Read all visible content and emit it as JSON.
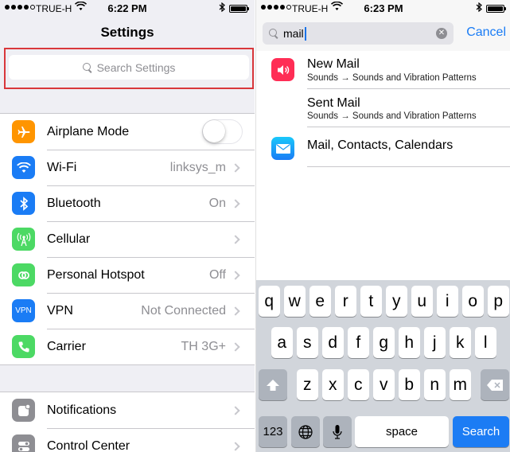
{
  "left": {
    "status": {
      "carrier": "TRUE-H",
      "time": "6:22 PM"
    },
    "title": "Settings",
    "search_placeholder": "Search Settings",
    "group1": [
      {
        "label": "Airplane Mode",
        "detail": "",
        "icon": "airplane-icon",
        "color": "#ff9500",
        "toggle": false
      },
      {
        "label": "Wi-Fi",
        "detail": "linksys_m",
        "icon": "wifi-icon",
        "color": "#1a7cf5"
      },
      {
        "label": "Bluetooth",
        "detail": "On",
        "icon": "bluetooth-icon",
        "color": "#1a7cf5"
      },
      {
        "label": "Cellular",
        "detail": "",
        "icon": "cellular-icon",
        "color": "#4cd964"
      },
      {
        "label": "Personal Hotspot",
        "detail": "Off",
        "icon": "hotspot-icon",
        "color": "#4cd964"
      },
      {
        "label": "VPN",
        "detail": "Not Connected",
        "icon": "vpn-icon",
        "color": "#1a7cf5",
        "icon_text": "VPN"
      },
      {
        "label": "Carrier",
        "detail": "TH 3G+",
        "icon": "phone-icon",
        "color": "#4cd964"
      }
    ],
    "group2": [
      {
        "label": "Notifications",
        "icon": "notifications-icon",
        "color": "#8e8e93"
      },
      {
        "label": "Control Center",
        "icon": "control-center-icon",
        "color": "#8e8e93"
      }
    ]
  },
  "right": {
    "status": {
      "carrier": "TRUE-H",
      "time": "6:23 PM"
    },
    "search_value": "mail",
    "cancel_label": "Cancel",
    "results": [
      {
        "title": "New Mail",
        "subtitle": "Sounds → Sounds and Vibration Patterns",
        "icon": "sounds-icon",
        "color": "#ff2d55"
      },
      {
        "title": "Sent Mail",
        "subtitle": "Sounds → Sounds and Vibration Patterns",
        "icon": "",
        "color": ""
      },
      {
        "title": "Mail, Contacts, Calendars",
        "subtitle": "",
        "icon": "mail-icon",
        "color": "#1a9bf4"
      }
    ],
    "keyboard": {
      "row1": [
        "q",
        "w",
        "e",
        "r",
        "t",
        "y",
        "u",
        "i",
        "o",
        "p"
      ],
      "row2": [
        "a",
        "s",
        "d",
        "f",
        "g",
        "h",
        "j",
        "k",
        "l"
      ],
      "row3": [
        "z",
        "x",
        "c",
        "v",
        "b",
        "n",
        "m"
      ],
      "numbers_label": "123",
      "space_label": "space",
      "search_label": "Search"
    }
  }
}
